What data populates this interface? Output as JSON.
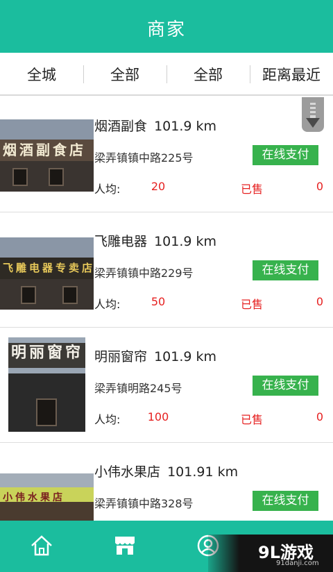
{
  "header": {
    "title": "商家"
  },
  "filters": [
    {
      "label": "全城"
    },
    {
      "label": "全部"
    },
    {
      "label": "全部"
    },
    {
      "label": "距离最近"
    }
  ],
  "merchants": [
    {
      "name": "烟酒副食",
      "distance": "101.9 km",
      "address": "梁弄镇镇中路225号",
      "pay_label": "在线支付",
      "avg_label": "人均:",
      "avg_value": "20",
      "sold_label": "已售",
      "sold_value": "0",
      "sign_text": "烟酒副食店"
    },
    {
      "name": "飞雕电器",
      "distance": "101.9 km",
      "address": "梁弄镇镇中路229号",
      "pay_label": "在线支付",
      "avg_label": "人均:",
      "avg_value": "50",
      "sold_label": "已售",
      "sold_value": "0",
      "sign_text": "飞雕电器专卖店"
    },
    {
      "name": "明丽窗帘",
      "distance": "101.9 km",
      "address": "梁弄镇明路245号",
      "pay_label": "在线支付",
      "avg_label": "人均:",
      "avg_value": "100",
      "sold_label": "已售",
      "sold_value": "0",
      "sign_text": "明丽窗帘"
    },
    {
      "name": "小伟水果店",
      "distance": "101.91 km",
      "address": "梁弄镇镇中路328号",
      "pay_label": "在线支付",
      "avg_label": "",
      "avg_value": "",
      "sold_label": "",
      "sold_value": "",
      "sign_text": "小伟水果店"
    }
  ],
  "tabbar": {
    "icons": [
      "home-icon",
      "store-icon",
      "user-icon"
    ]
  },
  "watermark": {
    "logo": "9L游戏",
    "url": "91danji.com"
  },
  "colors": {
    "primary": "#1bbd9e",
    "pay_button": "#37b24d",
    "price": "#e62020"
  }
}
